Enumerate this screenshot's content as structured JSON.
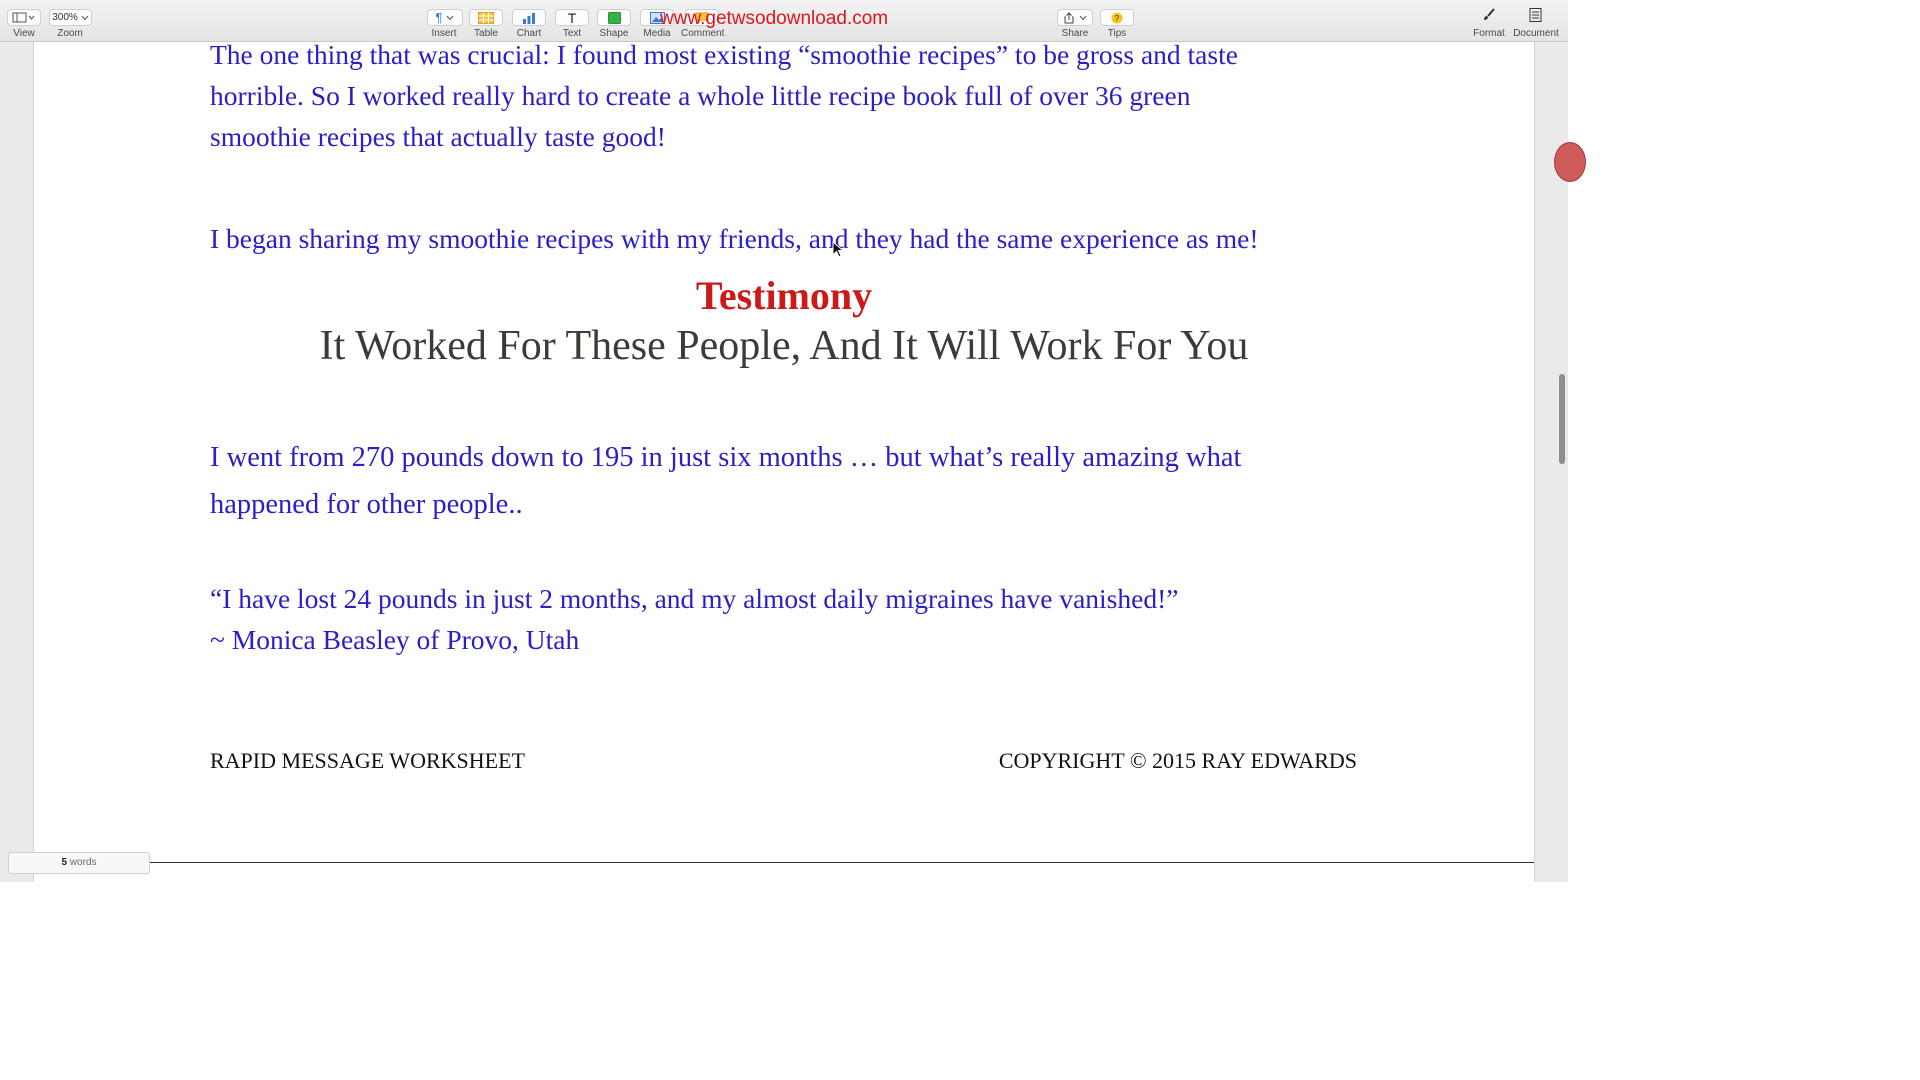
{
  "watermark": "www.getwsodownload.com",
  "toolbar": {
    "view_label": "View",
    "zoom_label": "Zoom",
    "zoom_value": "300%",
    "insert_label": "Insert",
    "table_label": "Table",
    "chart_label": "Chart",
    "text_label": "Text",
    "shape_label": "Shape",
    "media_label": "Media",
    "comment_label": "Comment",
    "share_label": "Share",
    "tips_label": "Tips",
    "format_label": "Format",
    "document_label": "Document"
  },
  "document": {
    "para1_line1": "The one thing that was crucial: I found most existing “smoothie recipes” to be gross and taste",
    "para1_line2": "horrible. So I worked really hard to create a whole little recipe book full of over 36 green",
    "para1_line3": "smoothie recipes that actually taste good!",
    "para2": "I began sharing my smoothie recipes with my friends, and they had the same experience as me!",
    "testimony_title": "Testimony",
    "testimony_subtitle": "It Worked For These People, And It Will Work For You",
    "para3_line1": "I went from 270 pounds down to 195 in just six months … but what’s really amazing what",
    "para3_line2": "happened for other people..",
    "quote": "“I have lost 24 pounds in just 2 months, and my almost daily migraines have vanished!”",
    "attribution": "~ Monica Beasley of Provo, Utah",
    "footer_left": "RAPID MESSAGE WORKSHEET",
    "footer_right": "COPYRIGHT © 2015 RAY EDWARDS"
  },
  "status": {
    "word_count": "5",
    "word_unit": "words"
  }
}
